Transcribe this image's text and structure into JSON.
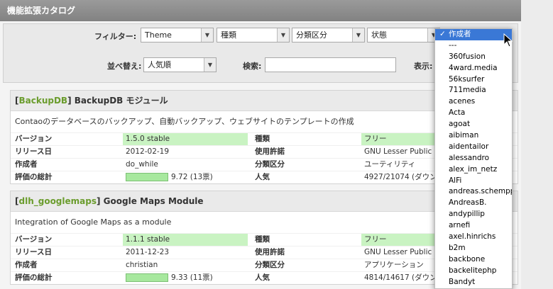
{
  "header": {
    "title": "機能拡張カタログ"
  },
  "filters": {
    "label": "フィルター:",
    "theme": "Theme",
    "type": "種類",
    "category": "分類区分",
    "status": "状態"
  },
  "sortbar": {
    "sort_label": "並べ替え:",
    "sort_value": "人気順",
    "search_label": "検索:",
    "search_value": "",
    "display_label": "表示:"
  },
  "extensions": [
    {
      "key": "BackupDB",
      "name": "BackupDB モジュール",
      "description": "Contaoのデータベースのバックアップ、自動バックアップ、ウェブサイトのテンプレートの作成",
      "version_label": "バージョン",
      "version": "1.5.0 stable",
      "type_label": "種類",
      "type": "フリー",
      "release_label": "リリース日",
      "release": "2012-02-19",
      "license_label": "使用許諾",
      "license": "GNU Lesser Public L",
      "author_label": "作成者",
      "author": "do_while",
      "category_label": "分類区分",
      "category": "ユーティリティ",
      "rating_label": "評価の総計",
      "rating": "9.72 (13票)",
      "popularity_label": "人気",
      "popularity": "4927/21074 (ダウン"
    },
    {
      "key": "dlh_googlemaps",
      "name": "Google Maps Module",
      "description": "Integration of Google Maps as a module",
      "version_label": "バージョン",
      "version": "1.1.1 stable",
      "type_label": "種類",
      "type": "フリー",
      "release_label": "リリース日",
      "release": "2011-12-23",
      "license_label": "使用許諾",
      "license": "GNU Lesser Public L",
      "author_label": "作成者",
      "author": "christian",
      "category_label": "分類区分",
      "category": "アプリケーション",
      "rating_label": "評価の総計",
      "rating": "9.33 (11票)",
      "popularity_label": "人気",
      "popularity": "4814/14617 (ダウン"
    }
  ],
  "dropdown": {
    "selected": "作成者",
    "check": "✓",
    "options": [
      "---",
      "360fusion",
      "4ward.media",
      "56ksurfer",
      "711media",
      "acenes",
      "Acta",
      "agoat",
      "aibiman",
      "aidentailor",
      "alessandro",
      "alex_im_netz",
      "AlFi",
      "andreas.schempp",
      "AndreasB.",
      "andypillip",
      "arnefi",
      "axel.hinrichs",
      "b2m",
      "backbone",
      "backelitephp",
      "Bandyt"
    ]
  },
  "colors": {
    "accent": "#6a9c2c",
    "highlight": "#3a78d6",
    "green_cell": "#c9f3c2"
  }
}
